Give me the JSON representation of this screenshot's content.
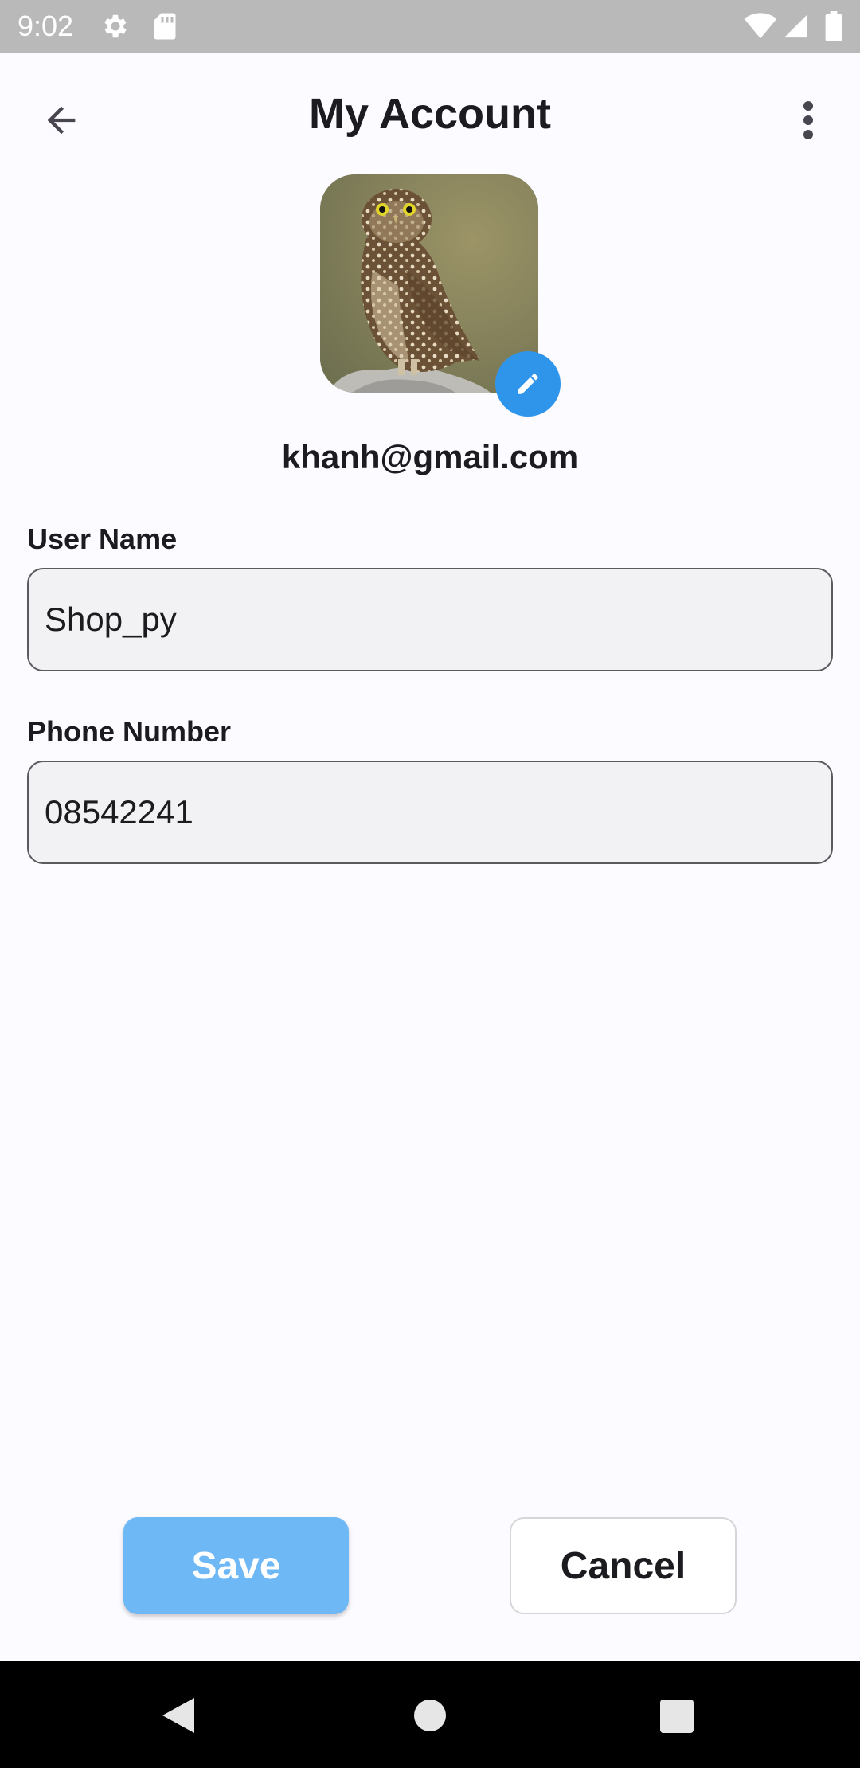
{
  "status_bar": {
    "time": "9:02",
    "icons": [
      "gear-icon",
      "sd-card-icon",
      "wifi-icon",
      "signal-icon",
      "battery-icon"
    ]
  },
  "app_bar": {
    "title": "My Account",
    "back_icon": "arrow-back-icon",
    "more_icon": "more-vert-icon"
  },
  "profile": {
    "avatar_description_icon": "owl-photo",
    "edit_icon": "pencil-icon",
    "email": "khanh@gmail.com"
  },
  "form": {
    "username": {
      "label": "User Name",
      "value": "Shop_py"
    },
    "phone": {
      "label": "Phone Number",
      "value": "08542241"
    }
  },
  "actions": {
    "save_label": "Save",
    "cancel_label": "Cancel"
  },
  "nav_bar": {
    "icons": [
      "nav-back-icon",
      "nav-home-icon",
      "nav-recents-icon"
    ]
  },
  "colors": {
    "accent": "#2f95eb",
    "save_button": "#6eb8f6",
    "status_bar": "#b9b9b9",
    "background": "#fcfbff"
  }
}
